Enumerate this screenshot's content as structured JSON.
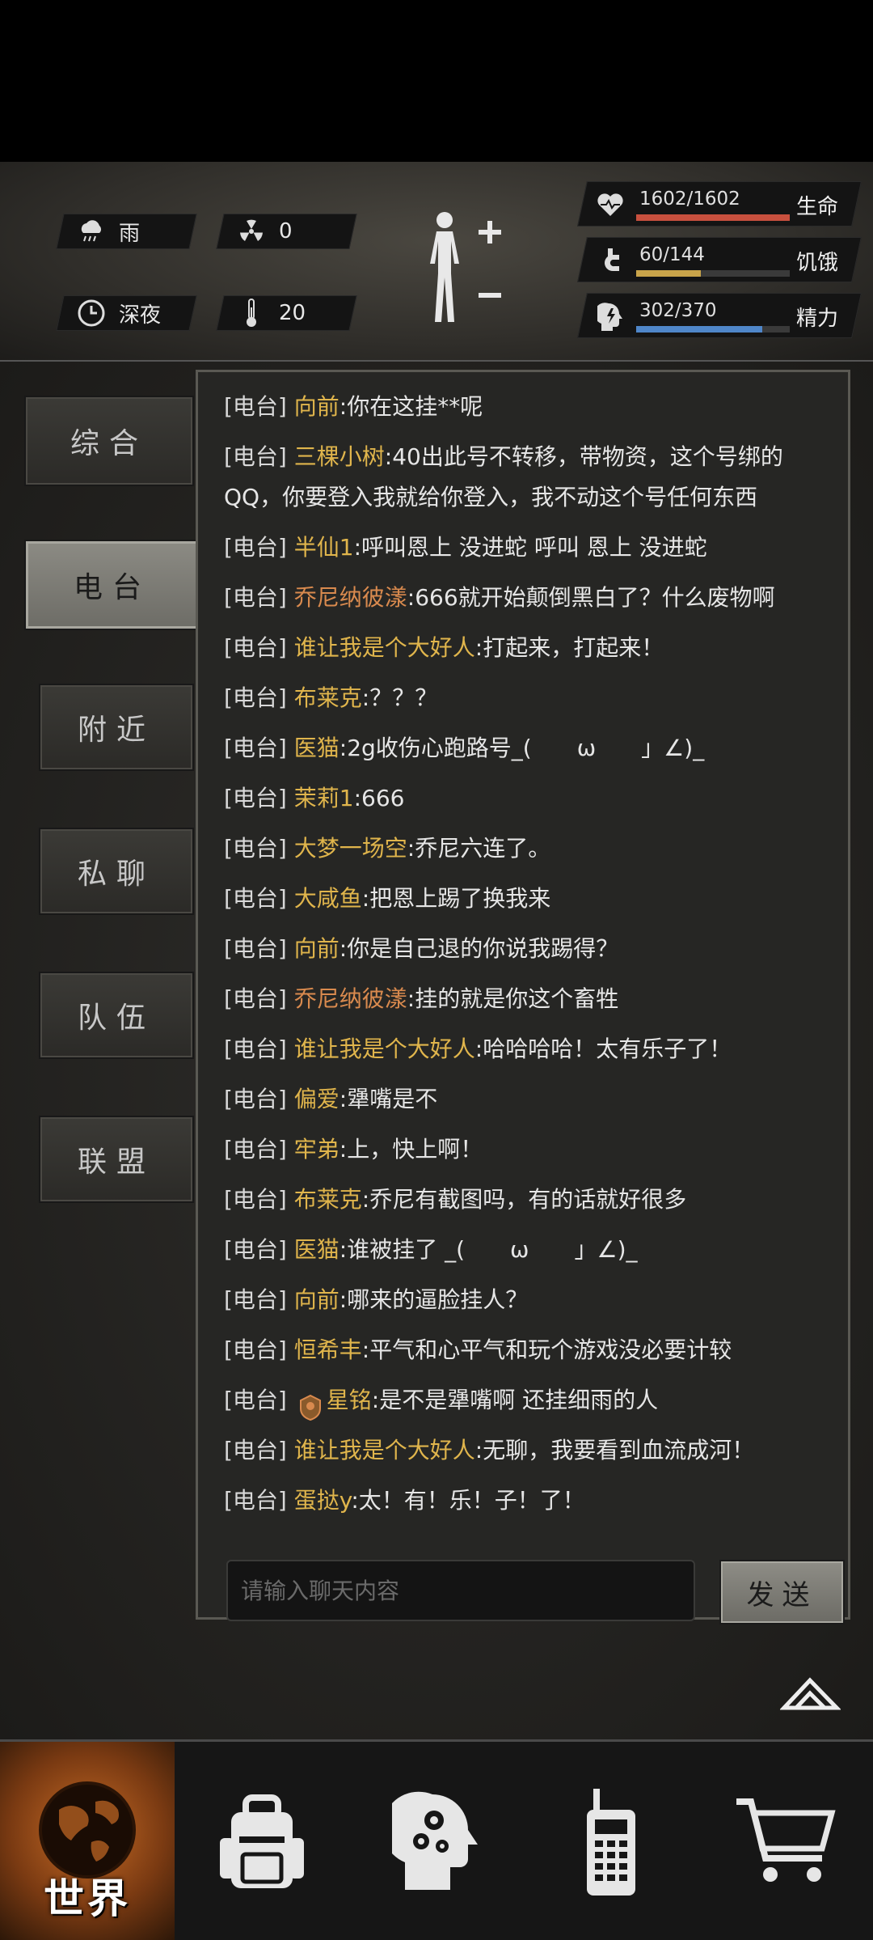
{
  "status": {
    "weather": "雨",
    "radiation": "0",
    "time_of_day": "深夜",
    "temperature": "20"
  },
  "vitals": [
    {
      "value": "1602/1602",
      "label": "生命",
      "fill": 1.0,
      "color": "#c8503e",
      "icon": "heart-pulse-icon"
    },
    {
      "value": "60/144",
      "label": "饥饿",
      "fill": 0.42,
      "color": "#c9a44a",
      "icon": "stomach-icon"
    },
    {
      "value": "302/370",
      "label": "精力",
      "fill": 0.82,
      "color": "#4f86c9",
      "icon": "head-energy-icon"
    }
  ],
  "tabs": [
    {
      "label": "综合"
    },
    {
      "label": "电台"
    },
    {
      "label": "附近"
    },
    {
      "label": "私聊"
    },
    {
      "label": "队伍"
    },
    {
      "label": "联盟"
    }
  ],
  "active_tab": "电台",
  "messages": [
    {
      "channel": "[电台]",
      "name": "向前",
      "text": ":你在这挂**呢",
      "name_color": "gold"
    },
    {
      "channel": "[电台]",
      "name": "三棵小树",
      "text": ":40出此号不转移，带物资，这个号绑的QQ，你要登入我就给你登入，我不动这个号任何东西",
      "name_color": "gold",
      "wrap": true
    },
    {
      "channel": "[电台]",
      "name": "半仙1",
      "text": ":呼叫恩上 没进蛇 呼叫 恩上 没进蛇",
      "name_color": "gold"
    },
    {
      "channel": "[电台]",
      "name": "乔尼纳彼漾",
      "text": ":666就开始颠倒黑白了？什么废物啊",
      "name_color": "orange"
    },
    {
      "channel": "[电台]",
      "name": "谁让我是个大好人",
      "text": ":打起来，打起来！",
      "name_color": "gold"
    },
    {
      "channel": "[电台]",
      "name": "布莱克",
      "text": ":？？？",
      "name_color": "gold"
    },
    {
      "channel": "[电台]",
      "name": "医猫",
      "text": ":2g收伤心跑路号_(　　ω　　」∠)_",
      "name_color": "gold"
    },
    {
      "channel": "[电台]",
      "name": "茉莉1",
      "text": ":666",
      "name_color": "gold"
    },
    {
      "channel": "[电台]",
      "name": "大梦一场空",
      "text": ":乔尼六连了。",
      "name_color": "gold"
    },
    {
      "channel": "[电台]",
      "name": "大咸鱼",
      "text": ":把恩上踢了换我来",
      "name_color": "gold"
    },
    {
      "channel": "[电台]",
      "name": "向前",
      "text": ":你是自己退的你说我踢得？",
      "name_color": "gold"
    },
    {
      "channel": "[电台]",
      "name": "乔尼纳彼漾",
      "text": ":挂的就是你这个畜牲",
      "name_color": "orange"
    },
    {
      "channel": "[电台]",
      "name": "谁让我是个大好人",
      "text": ":哈哈哈哈！太有乐子了！",
      "name_color": "gold"
    },
    {
      "channel": "[电台]",
      "name": "偏爱",
      "text": ":犟嘴是不",
      "name_color": "gold"
    },
    {
      "channel": "[电台]",
      "name": "牢弟",
      "text": ":上，快上啊！",
      "name_color": "gold"
    },
    {
      "channel": "[电台]",
      "name": "布莱克",
      "text": ":乔尼有截图吗，有的话就好很多",
      "name_color": "gold"
    },
    {
      "channel": "[电台]",
      "name": "医猫",
      "text": ":谁被挂了 _(　　ω　　」∠)_",
      "name_color": "gold"
    },
    {
      "channel": "[电台]",
      "name": "向前",
      "text": ":哪来的逼脸挂人？",
      "name_color": "gold"
    },
    {
      "channel": "[电台]",
      "name": "恒希丰",
      "text": ":平气和心平气和玩个游戏没必要计较",
      "name_color": "gold"
    },
    {
      "channel": "[电台]",
      "name": "星铭",
      "text": ":是不是犟嘴啊 还挂细雨的人",
      "name_color": "gold",
      "avatar": true
    },
    {
      "channel": "[电台]",
      "name": "谁让我是个大好人",
      "text": ":无聊，我要看到血流成河！",
      "name_color": "gold"
    },
    {
      "channel": "[电台]",
      "name": "蛋挞y",
      "text": ":太！有！乐！子！了！",
      "name_color": "gold"
    }
  ],
  "chat_input": {
    "placeholder": "请输入聊天内容",
    "value": ""
  },
  "send_label": "发送",
  "bottom_nav": [
    {
      "label": "世界",
      "icon": "globe-icon",
      "active": true
    },
    {
      "label": "",
      "icon": "backpack-icon"
    },
    {
      "label": "",
      "icon": "head-gears-icon"
    },
    {
      "label": "",
      "icon": "walkie-talkie-icon"
    },
    {
      "label": "",
      "icon": "shopping-cart-icon"
    }
  ]
}
